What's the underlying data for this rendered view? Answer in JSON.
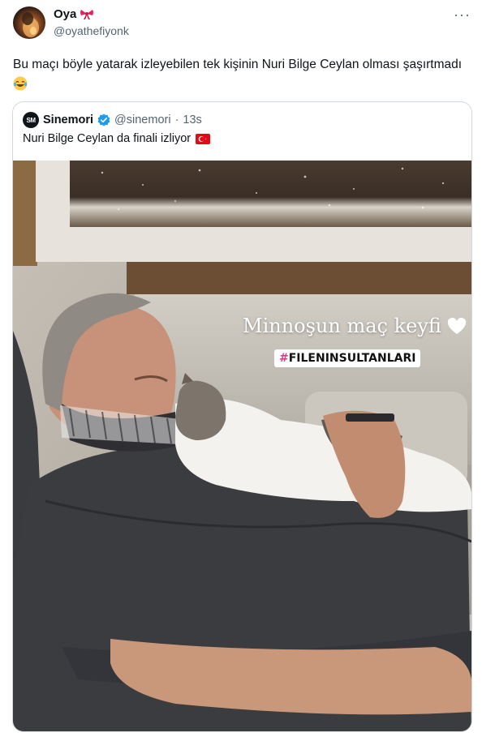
{
  "author": {
    "display_name": "Oya",
    "handle": "@oyathefiyonk",
    "name_emoji": "bow-icon"
  },
  "tweet": {
    "text": "Bu maçı böyle yatarak izleyebilen tek kişinin Nuri Bilge Ceylan olması şaşırtmadı",
    "trailing_emoji": "laughing-tears-icon"
  },
  "quoted": {
    "avatar_text": "SM",
    "name": "Sinemori",
    "handle": "@sinemori",
    "separator": "·",
    "time": "13s",
    "text": "Nuri Bilge Ceylan da finali izliyor",
    "flag": "turkey-flag-icon",
    "verified": true
  },
  "media": {
    "overlay_caption": "Minnoşun maç keyfi",
    "overlay_heart": "white-heart-icon",
    "hashtag_symbol": "#",
    "hashtag_text": "FILENINSULTANLARI"
  },
  "colors": {
    "text": "#0f1419",
    "secondary": "#536471",
    "border": "#cfd9de",
    "verified": "#1d9bf0",
    "flag": "#e30a17"
  },
  "more_label": "···"
}
